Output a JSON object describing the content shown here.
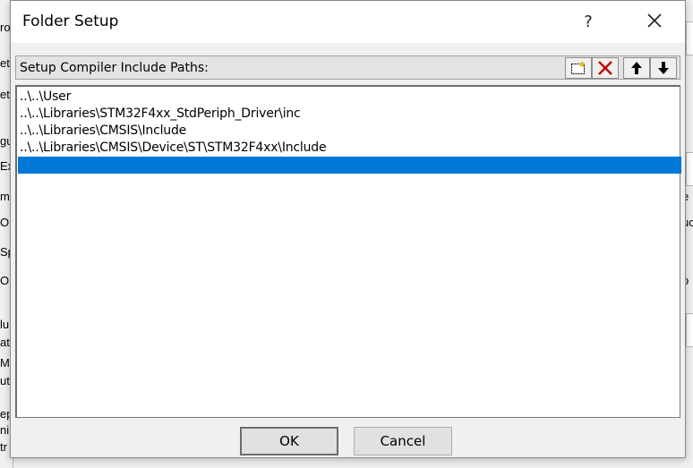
{
  "background": {
    "left_fragments": [
      "ro",
      "et",
      "et",
      "gu",
      "Ex",
      "mi",
      "Op",
      "Sp",
      "Or",
      "lu",
      "at",
      "M",
      "utr",
      "ep",
      "ni",
      "tr"
    ],
    "right_fragments": [
      "e",
      "uc",
      "o"
    ]
  },
  "dialog": {
    "title": "Folder Setup",
    "help_label": "?",
    "group_label": "Setup Compiler Include Paths:",
    "paths": [
      "..\\..\\User",
      "..\\..\\Libraries\\STM32F4xx_StdPeriph_Driver\\inc",
      "..\\..\\Libraries\\CMSIS\\Include",
      "..\\..\\Libraries\\CMSIS\\Device\\ST\\STM32F4xx\\Include",
      ""
    ],
    "ok_label": "OK",
    "cancel_label": "Cancel"
  },
  "colors": {
    "selection": "#0078d7",
    "delete_red": "#c00000"
  }
}
